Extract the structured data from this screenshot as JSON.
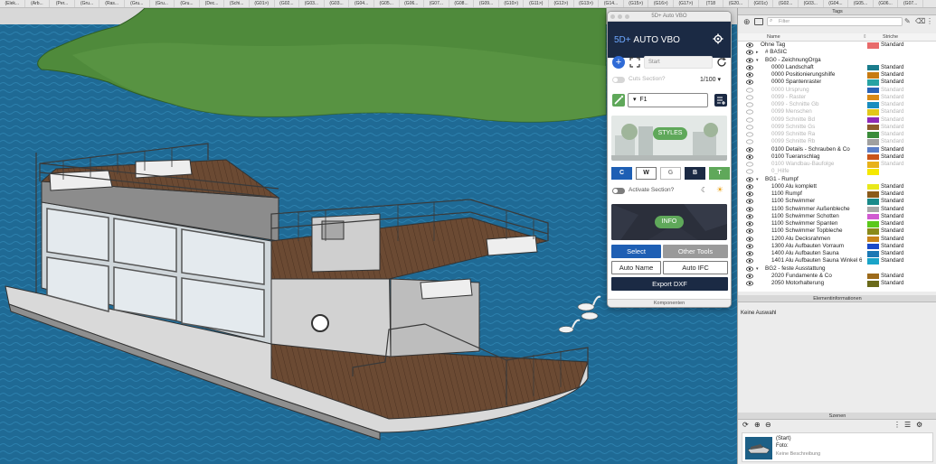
{
  "scene_tabs": [
    "(Elek...",
    "(Arb...",
    "(Per...",
    "(Gru...",
    "(Ras...",
    "(Gru...",
    "(Gru...",
    "(Gru...",
    "(Dec...",
    "(Schi...",
    "(G01>)",
    "(G02...",
    "(G03...",
    "(G03...",
    "(G04...",
    "(G05...",
    "(G06...",
    "(G07...",
    "(G08...",
    "(G09...",
    "(G10>)",
    "(G11>)",
    "(G12>)",
    "(G13>)",
    "(G14...",
    "(G15>)",
    "(G16>)",
    "(G17>)",
    "(T18",
    "(G20...",
    "(G01c)",
    "(G02...",
    "(G03...",
    "(G04...",
    "(G05...",
    "(G06...",
    "(G07..."
  ],
  "panel": {
    "window_title": "5D+ Auto VBO",
    "brand_prefix": "5D+",
    "brand_name": "AUTO VBO",
    "start_placeholder": "Start",
    "add_label": "+",
    "cuts_label": "Cuts Section?",
    "counter": "1/100",
    "dropdown_value": "F1",
    "styles_label": "STYLES",
    "mode_buttons": [
      "C",
      "W",
      "G",
      "B",
      "T"
    ],
    "activate_label": "Activate Section?",
    "info_label": "INFO",
    "select_label": "Select",
    "other_tools_label": "Other Tools",
    "auto_name_label": "Auto Name",
    "auto_ifc_label": "Auto IFC",
    "export_label": "Export DXF",
    "footer_label": "Komponenten"
  },
  "tags_panel": {
    "title": "Tags",
    "filter_placeholder": "Filter",
    "col_name": "Name",
    "col_strokes": "Striche",
    "rows": [
      {
        "name": "Ohne Tag",
        "style": "Standard",
        "color": "#e86a6a",
        "level": 0,
        "visible": true,
        "group": false
      },
      {
        "name": "# BASIC",
        "style": "",
        "color": "",
        "level": 0,
        "visible": true,
        "group": true
      },
      {
        "name": "BG0 - ZeichnungOrga",
        "style": "",
        "color": "",
        "level": 0,
        "visible": true,
        "group": true,
        "open": true
      },
      {
        "name": "0000 Landschaft",
        "style": "Standard",
        "color": "#1a7c8c",
        "level": 1,
        "visible": true,
        "group": false
      },
      {
        "name": "0000 Positionierungshilfe",
        "style": "Standard",
        "color": "#c77b12",
        "level": 1,
        "visible": true,
        "group": false
      },
      {
        "name": "0000 Spantenraster",
        "style": "Standard",
        "color": "#27a3a3",
        "level": 1,
        "visible": true,
        "group": false
      },
      {
        "name": "0000 Ursprung",
        "style": "Standard",
        "color": "#2a63b8",
        "level": 1,
        "visible": false,
        "group": false
      },
      {
        "name": "0099 - Raster",
        "style": "Standard",
        "color": "#d88a18",
        "level": 1,
        "visible": false,
        "group": false
      },
      {
        "name": "0099 - Schnitte Gb",
        "style": "Standard",
        "color": "#1a8dbf",
        "level": 1,
        "visible": false,
        "group": false
      },
      {
        "name": "0099 Menschen",
        "style": "Standard",
        "color": "#e2c71a",
        "level": 1,
        "visible": false,
        "group": false
      },
      {
        "name": "0099 Schnitte Bd",
        "style": "Standard",
        "color": "#8e2ab8",
        "level": 1,
        "visible": false,
        "group": false
      },
      {
        "name": "0099 Schnitte Gs",
        "style": "Standard",
        "color": "#8c5c2c",
        "level": 1,
        "visible": false,
        "group": false
      },
      {
        "name": "0099 Schnitte Ra",
        "style": "Standard",
        "color": "#3a8c3a",
        "level": 1,
        "visible": false,
        "group": false
      },
      {
        "name": "0099 Schnitte Rb",
        "style": "Standard",
        "color": "#a0a0a0",
        "level": 1,
        "visible": false,
        "group": false
      },
      {
        "name": "0100 Details - Schrauben & Co",
        "style": "Standard",
        "color": "#5b7ec8",
        "level": 1,
        "visible": true,
        "group": false
      },
      {
        "name": "0100 Tueranschlag",
        "style": "Standard",
        "color": "#c9541a",
        "level": 1,
        "visible": true,
        "group": false
      },
      {
        "name": "0100 Wandbau-Baufolge",
        "style": "Standard",
        "color": "#e8b21a",
        "level": 1,
        "visible": false,
        "group": false
      },
      {
        "name": "0_Hilfe",
        "style": "",
        "color": "#f5e800",
        "level": 1,
        "visible": false,
        "group": false
      },
      {
        "name": "BG1 - Rumpf",
        "style": "",
        "color": "",
        "level": 0,
        "visible": true,
        "group": true,
        "open": true
      },
      {
        "name": "1000 Alu komplett",
        "style": "Standard",
        "color": "#e8e81a",
        "level": 1,
        "visible": true,
        "group": false
      },
      {
        "name": "1100 Rumpf",
        "style": "Standard",
        "color": "#8a5a1a",
        "level": 1,
        "visible": true,
        "group": false
      },
      {
        "name": "1100 Schwimmer",
        "style": "Standard",
        "color": "#1a8a8a",
        "level": 1,
        "visible": true,
        "group": false
      },
      {
        "name": "1100 Schwimmer Außenbleche",
        "style": "Standard",
        "color": "#a8a8a8",
        "level": 1,
        "visible": true,
        "group": false
      },
      {
        "name": "1100 Schwimmer Schotten",
        "style": "Standard",
        "color": "#d15ad1",
        "level": 1,
        "visible": true,
        "group": false
      },
      {
        "name": "1100 Schwimmer Spanten",
        "style": "Standard",
        "color": "#5ac81a",
        "level": 1,
        "visible": true,
        "group": false
      },
      {
        "name": "1100 Schwimmer Topbleche",
        "style": "Standard",
        "color": "#8a8a1a",
        "level": 1,
        "visible": true,
        "group": false
      },
      {
        "name": "1200 Alu Decksrahmen",
        "style": "Standard",
        "color": "#c8841a",
        "level": 1,
        "visible": true,
        "group": false
      },
      {
        "name": "1300 Alu Aufbauten Vorraum",
        "style": "Standard",
        "color": "#1a4ac8",
        "level": 1,
        "visible": true,
        "group": false
      },
      {
        "name": "1400 Alu Aufbauten Sauna",
        "style": "Standard",
        "color": "#1a78b4",
        "level": 1,
        "visible": true,
        "group": false
      },
      {
        "name": "1401 Alu Aufbauten Sauna Winkel 6",
        "style": "Standard",
        "color": "#1aa4c8",
        "level": 1,
        "visible": true,
        "group": false
      },
      {
        "name": "BG2 - feste Ausstattung",
        "style": "",
        "color": "",
        "level": 0,
        "visible": true,
        "group": true,
        "open": true
      },
      {
        "name": "2020 Fundamente & Co",
        "style": "Standard",
        "color": "#9c6a1a",
        "level": 1,
        "visible": true,
        "group": false
      },
      {
        "name": "2050 Motorhalterung",
        "style": "Standard",
        "color": "#6a6a1a",
        "level": 1,
        "visible": true,
        "group": false
      }
    ]
  },
  "element_info": {
    "title": "Elementinformationen",
    "body": "Keine Auswahl"
  },
  "scenes": {
    "title": "Szenen",
    "item_name": "(Start)",
    "item_photo": "Foto:",
    "item_desc": "Keine Beschreibung"
  }
}
